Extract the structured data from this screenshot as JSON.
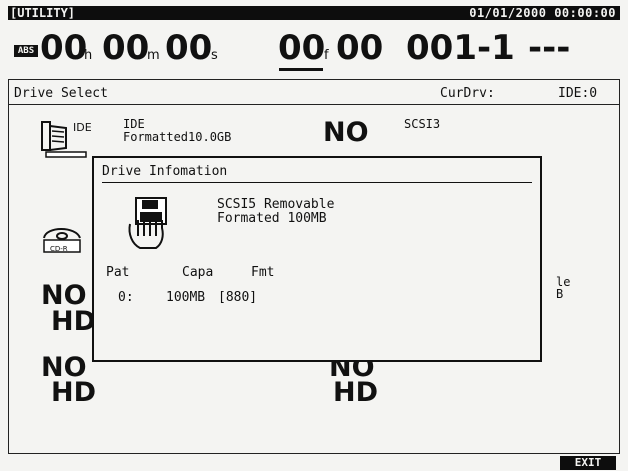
{
  "title_bar": {
    "mode": "[UTILITY]",
    "datetime": "01/01/2000 00:00:00"
  },
  "counter": {
    "abs_badge": "ABS",
    "hours": "00",
    "hours_unit": "h",
    "minutes": "00",
    "minutes_unit": "m",
    "seconds": "00",
    "seconds_unit": "s",
    "frames": "00",
    "frames_unit": "f",
    "subframes": "00",
    "scene": "001-1",
    "marker": "---"
  },
  "header": {
    "title": "Drive Select",
    "cur_drv_label": "CurDrv:",
    "cur_drv_value": "IDE:0"
  },
  "drives": {
    "ide": {
      "icon_label": "IDE",
      "name": "IDE",
      "status": "Formatted10.0GB",
      "big_label": "NO"
    },
    "scsi3": {
      "name": "SCSI3"
    },
    "cdr": {
      "icon_label": "CD-R",
      "big_top": "NO",
      "big_bottom": "HD"
    },
    "left_bottom": {
      "big_top": "NO",
      "big_bottom": "HD"
    },
    "right_bottom": {
      "big_top": "NO",
      "big_bottom": "HD"
    },
    "right_partial": {
      "line1": "le",
      "line2": "B"
    }
  },
  "dialog": {
    "title": "Drive Infomation",
    "drive_name": "SCSI5 Removable",
    "drive_status": "Formated 100MB",
    "columns": {
      "pat": "Pat",
      "capa": "Capa",
      "fmt": "Fmt"
    },
    "rows": [
      {
        "pat": "0:",
        "capa": "100MB",
        "fmt": "[880]"
      }
    ]
  },
  "footer": {
    "exit_label": "EXIT"
  }
}
